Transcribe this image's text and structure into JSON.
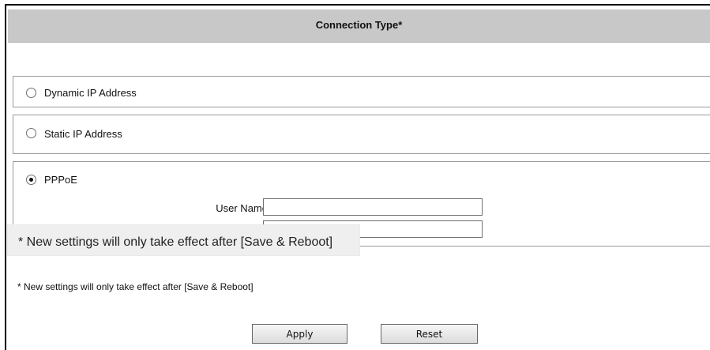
{
  "header": {
    "title": "Connection Type*"
  },
  "options": [
    {
      "label": "Dynamic IP Address",
      "selected": false
    },
    {
      "label": "Static IP Address",
      "selected": false
    },
    {
      "label": "PPPoE",
      "selected": true
    }
  ],
  "pppoe": {
    "username_label": "User Name",
    "username_value": "",
    "password_value": ""
  },
  "tooltip": {
    "text": "* New settings will only take effect after [Save & Reboot]"
  },
  "note": "* New settings will only take effect after [Save & Reboot]",
  "buttons": {
    "apply": "Apply",
    "reset": "Reset"
  }
}
